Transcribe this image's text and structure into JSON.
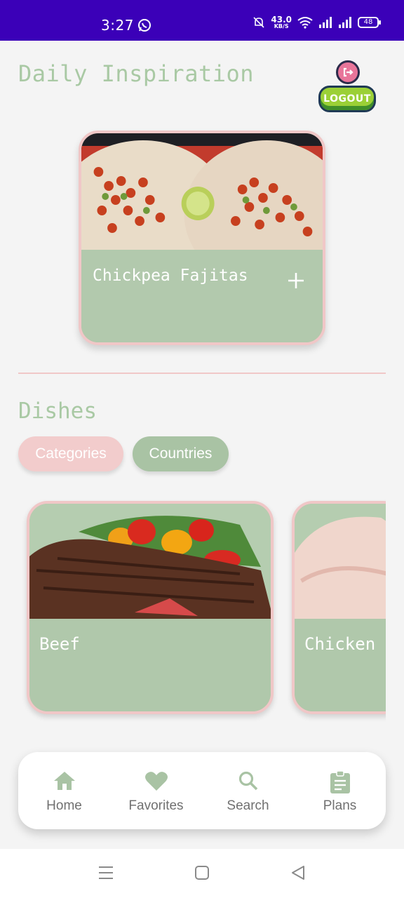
{
  "status_bar": {
    "time": "3:27",
    "net_speed_value": "43.0",
    "net_speed_unit": "KB/S",
    "battery": "48"
  },
  "header": {
    "title": "Daily Inspiration",
    "logout_label": "LOGOUT"
  },
  "daily_meal": {
    "name": "Chickpea Fajitas"
  },
  "dishes": {
    "title": "Dishes",
    "tabs": [
      {
        "label": "Categories",
        "color": "#f2cccc"
      },
      {
        "label": "Countries",
        "color": "#a9c3a4"
      }
    ],
    "categories": [
      {
        "name": "Beef"
      },
      {
        "name": "Chicken"
      }
    ]
  },
  "bottom_nav": {
    "items": [
      {
        "label": "Home",
        "icon": "home-icon"
      },
      {
        "label": "Favorites",
        "icon": "heart-icon"
      },
      {
        "label": "Search",
        "icon": "search-icon"
      },
      {
        "label": "Plans",
        "icon": "clipboard-icon"
      }
    ]
  },
  "colors": {
    "accent_green": "#a9c9a4",
    "accent_pink": "#f0c7c7",
    "status_bar": "#3b00b8"
  }
}
